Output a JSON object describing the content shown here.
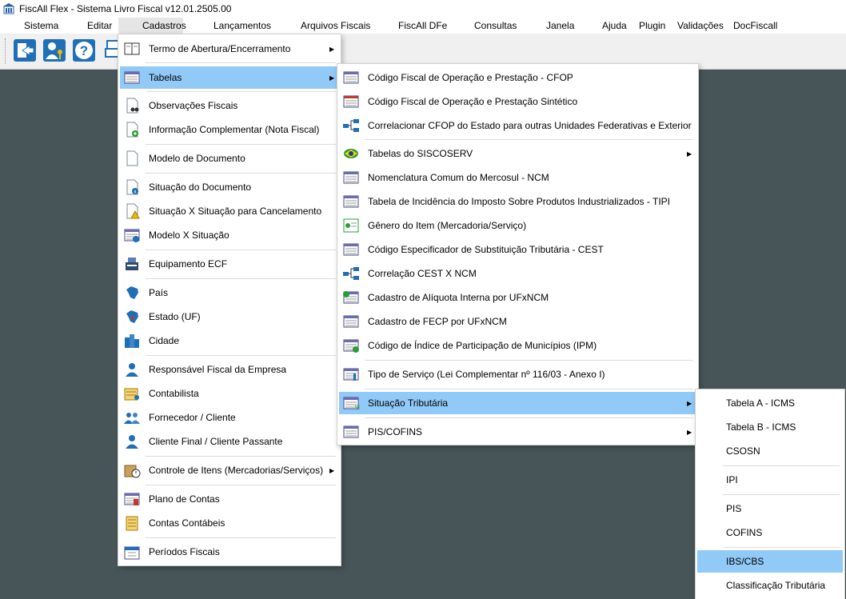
{
  "window": {
    "title": "FiscAll Flex - Sistema Livro Fiscal v12.01.2505.00"
  },
  "menubar": {
    "items": [
      "Sistema",
      "Editar",
      "Cadastros",
      "Lançamentos",
      "Arquivos Fiscais",
      "FiscAll DFe",
      "Consultas",
      "Janela",
      "Ajuda",
      "Plugin",
      "Validações",
      "DocFiscall"
    ],
    "active": "Cadastros"
  },
  "toolbar": {
    "icons": [
      "exit-icon",
      "users-key-icon",
      "help-icon",
      "printer-icon"
    ]
  },
  "cadastros_menu": {
    "items": [
      {
        "label": "Termo de Abertura/Encerramento",
        "icon": "book-icon",
        "submenu": true
      },
      {
        "label": "Tabelas",
        "icon": "table-list-icon",
        "submenu": true,
        "highlighted": true
      },
      {
        "label": "Observações Fiscais",
        "icon": "document-binoculars-icon"
      },
      {
        "label": "Informação Complementar (Nota Fiscal)",
        "icon": "document-add-icon"
      },
      {
        "label": "Modelo de Documento",
        "icon": "blank-document-icon"
      },
      {
        "label": "Situação do Documento",
        "icon": "document-info-icon"
      },
      {
        "label": "Situação X Situação para Cancelamento",
        "icon": "document-warning-icon"
      },
      {
        "label": "Modelo X Situação",
        "icon": "document-info-table-icon"
      },
      {
        "label": "Equipamento ECF",
        "icon": "cash-register-icon"
      },
      {
        "label": "País",
        "icon": "brazil-map-icon"
      },
      {
        "label": "Estado (UF)",
        "icon": "brazil-state-map-icon"
      },
      {
        "label": "Cidade",
        "icon": "city-buildings-icon"
      },
      {
        "label": "Responsável Fiscal da Empresa",
        "icon": "user-tie-icon"
      },
      {
        "label": "Contabilista",
        "icon": "accountant-icon"
      },
      {
        "label": "Fornecedor / Cliente",
        "icon": "users-group-icon"
      },
      {
        "label": "Cliente Final / Cliente Passante",
        "icon": "user-icon"
      },
      {
        "label": "Controle de Itens (Mercadorias/Serviços)",
        "icon": "box-clock-icon",
        "submenu": true
      },
      {
        "label": "Plano de Contas",
        "icon": "chart-of-accounts-icon"
      },
      {
        "label": "Contas Contábeis",
        "icon": "accounts-ledger-icon"
      },
      {
        "label": "Períodos Fiscais",
        "icon": "calendar-icon"
      }
    ]
  },
  "tabelas_menu": {
    "items": [
      {
        "label": "Código Fiscal de Operação e Prestação - CFOP",
        "icon": "cfop-table-icon"
      },
      {
        "label": "Código Fiscal de Operação e Prestação Sintético",
        "icon": "cfop-sintetico-icon"
      },
      {
        "label": "Correlacionar CFOP do Estado para outras Unidades Federativas e Exterior",
        "icon": "correlation-icon"
      },
      {
        "label": "Tabelas do SISCOSERV",
        "icon": "siscoserv-icon",
        "submenu": true
      },
      {
        "label": "Nomenclatura Comum do Mercosul  - NCM",
        "icon": "ncm-table-icon"
      },
      {
        "label": "Tabela de Incidência do Imposto Sobre Produtos Industrializados - TIPI",
        "icon": "tipi-table-icon"
      },
      {
        "label": "Gênero do Item (Mercadoria/Serviço)",
        "icon": "item-genre-icon"
      },
      {
        "label": "Código Especificador de Substituição Tributária - CEST",
        "icon": "cest-table-icon"
      },
      {
        "label": "Correlação CEST X NCM",
        "icon": "correlation-icon"
      },
      {
        "label": "Cadastro de Alíquota Interna por UFxNCM",
        "icon": "aliquota-table-icon"
      },
      {
        "label": "Cadastro de FECP por UFxNCM",
        "icon": "fecp-table-icon"
      },
      {
        "label": "Código de Índice de Participação de Municípios (IPM)",
        "icon": "ipm-table-add-icon"
      },
      {
        "label": "Tipo de Serviço (Lei Complementar nº 116/03 - Anexo I)",
        "icon": "service-type-icon"
      },
      {
        "label": "Situação Tributária",
        "icon": "tax-status-icon",
        "submenu": true,
        "highlighted": true
      },
      {
        "label": "PIS/COFINS",
        "icon": "pis-cofins-table-icon",
        "submenu": true
      }
    ]
  },
  "situacao_menu": {
    "items": [
      {
        "label": "Tabela A - ICMS"
      },
      {
        "label": "Tabela B - ICMS"
      },
      {
        "label": "CSOSN"
      },
      {
        "label": "IPI"
      },
      {
        "label": "PIS"
      },
      {
        "label": "COFINS"
      },
      {
        "label": "IBS/CBS",
        "highlighted": true
      },
      {
        "label": "Classificação Tributária"
      }
    ]
  },
  "colors": {
    "highlight": "#91c9f7",
    "workspace": "#475559",
    "accent_blue": "#1f6fb8"
  }
}
